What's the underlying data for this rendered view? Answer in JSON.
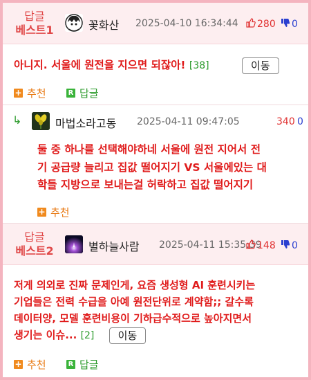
{
  "comments": [
    {
      "best_label_1": "답글",
      "best_label_2": "베스트1",
      "nickname": "꽃화산",
      "date": "2025-04-10 16:34:44",
      "upvotes": "280",
      "downvotes": "0",
      "body": "아니지. 서울에 원전을 지으면 되잖아!",
      "reply_count": "[38]",
      "move_label": "이동",
      "recommend_label": "추천",
      "reply_label": "답글"
    },
    {
      "nickname": "마법소라고동",
      "date": "2025-04-11 09:47:05",
      "upvotes": "340",
      "downvotes": "0",
      "body_lines": [
        "둘 중 하나를 선택해야하네 서울에 원전 지어서 전",
        "기 공급량 늘리고 집값 떨어지기 VS 서울에있는 대",
        "학들 지방으로 보내는걸 허락하고 집값 떨어지기"
      ],
      "recommend_label": "추천"
    },
    {
      "best_label_1": "답글",
      "best_label_2": "베스트2",
      "nickname": "별하늘사람",
      "date": "2025-04-11 15:35:39",
      "upvotes": "148",
      "downvotes": "0",
      "body_lines": [
        "저게 의외로 진짜 문제인게, 요즘 생성형 AI 훈련시키는",
        "기업들은 전력 수급을 아예 원전단위로 계약함;; 갈수록",
        "데이터양, 모델 훈련비용이 기하급수적으로 높아지면서",
        "생기는 이슈..."
      ],
      "reply_count": "[2]",
      "move_label": "이동",
      "recommend_label": "추천",
      "reply_label": "답글"
    }
  ],
  "colors": {
    "frame": "#f4b4bf",
    "best_bg": "#fdeef0",
    "text_red": "#e01b1b",
    "green": "#2a9a2a",
    "orange": "#f08a1e",
    "blue": "#2a3fd0"
  },
  "icons": [
    "thumbs-up-icon",
    "thumbs-down-icon",
    "plus-icon",
    "reply-r-icon",
    "reply-arrow-icon"
  ]
}
